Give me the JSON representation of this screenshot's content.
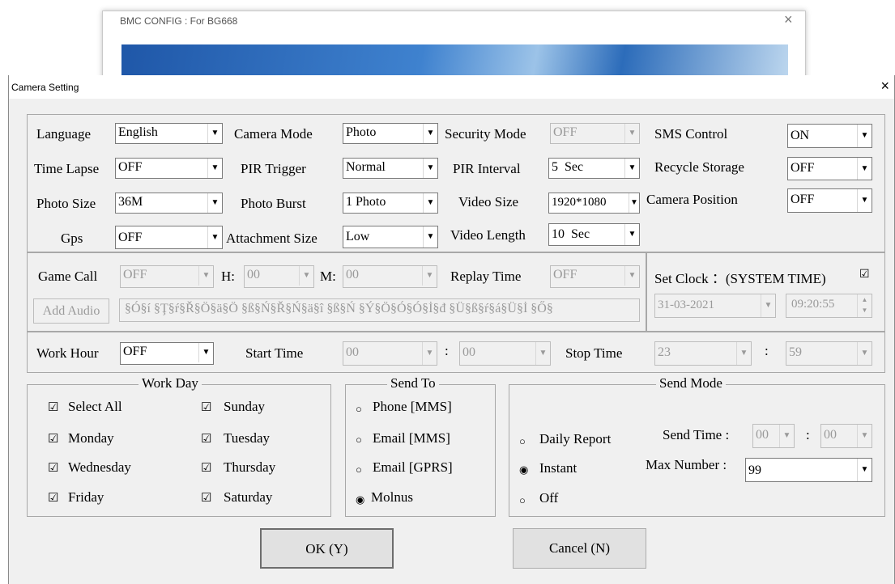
{
  "background_window": {
    "title": "BMC CONFIG : For BG668",
    "close_glyph": "×"
  },
  "dialog": {
    "title": "Camera Setting",
    "close_glyph": "×"
  },
  "settings": {
    "language": {
      "label": "Language",
      "value": "English"
    },
    "camera_mode": {
      "label": "Camera Mode",
      "value": "Photo"
    },
    "security_mode": {
      "label": "Security Mode",
      "value": "OFF"
    },
    "sms_control": {
      "label": "SMS Control",
      "value": "ON"
    },
    "time_lapse": {
      "label": "Time Lapse",
      "value": "OFF"
    },
    "pir_trigger": {
      "label": "PIR Trigger",
      "value": "Normal"
    },
    "pir_interval": {
      "label": "PIR Interval",
      "value": "5  Sec"
    },
    "recycle_storage": {
      "label": "Recycle Storage",
      "value": "OFF"
    },
    "photo_size": {
      "label": "Photo Size",
      "value": "36M"
    },
    "photo_burst": {
      "label": "Photo Burst",
      "value": "1 Photo"
    },
    "video_size": {
      "label": "Video Size",
      "value": "1920*1080"
    },
    "camera_position": {
      "label": "Camera Position",
      "value": "OFF"
    },
    "gps": {
      "label": "Gps",
      "value": "OFF"
    },
    "attachment_size": {
      "label": "Attachment Size",
      "value": "Low"
    },
    "video_length": {
      "label": "Video Length",
      "value": "10  Sec"
    }
  },
  "game_call": {
    "label": "Game Call",
    "value": "OFF",
    "h_label": "H:",
    "h_value": "00",
    "m_label": "M:",
    "m_value": "00",
    "replay_label": "Replay Time",
    "replay_value": "OFF",
    "add_audio_label": "Add Audio",
    "audio_text": "§Ó§í §Ţ§ŕ§Ř§Ö§ä§Ö §ß§Ń§Ř§Ń§ä§î §ß§Ń §Ý§Ö§Ó§Ó§İ§đ §Ü§ß§ŕ§á§Ü§İ §Ő§"
  },
  "clock": {
    "label": "Set Clock ：(SYSTEM TIME)",
    "checked": true,
    "check_glyph": "☑",
    "date": "31-03-2021",
    "time": "09:20:55"
  },
  "work_hour": {
    "label": "Work Hour",
    "value": "OFF",
    "start_label": "Start Time",
    "start_h": "00",
    "start_m": "00",
    "colon": ":",
    "stop_label": "Stop Time",
    "stop_h": "23",
    "stop_m": "59"
  },
  "work_day": {
    "legend": "Work Day",
    "items": [
      {
        "label": "Select All",
        "glyph": "☑"
      },
      {
        "label": "Sunday",
        "glyph": "☑"
      },
      {
        "label": "Monday",
        "glyph": "☑"
      },
      {
        "label": "Tuesday",
        "glyph": "☑"
      },
      {
        "label": "Wednesday",
        "glyph": "☑"
      },
      {
        "label": "Thursday",
        "glyph": "☑"
      },
      {
        "label": "Friday",
        "glyph": "☑"
      },
      {
        "label": "Saturday",
        "glyph": "☑"
      }
    ]
  },
  "send_to": {
    "legend": "Send To",
    "options": [
      {
        "label": "Phone [MMS]",
        "glyph": "○"
      },
      {
        "label": "Email [MMS]",
        "glyph": "○"
      },
      {
        "label": "Email [GPRS]",
        "glyph": "○"
      },
      {
        "label": "Molnus",
        "glyph": "◉"
      }
    ]
  },
  "send_mode": {
    "legend": "Send Mode",
    "options": [
      {
        "label": "Daily Report",
        "glyph": "○"
      },
      {
        "label": "Instant",
        "glyph": "◉"
      },
      {
        "label": "Off",
        "glyph": "○"
      }
    ],
    "send_time_label": "Send Time :",
    "send_time_h": "00",
    "send_time_m": "00",
    "colon": ":",
    "max_number_label": "Max Number :",
    "max_number_value": "99"
  },
  "buttons": {
    "ok": "OK (Y)",
    "cancel": "Cancel (N)"
  },
  "glyphs": {
    "arrow": "▼",
    "spin_up": "▲",
    "spin_down": "▼"
  }
}
